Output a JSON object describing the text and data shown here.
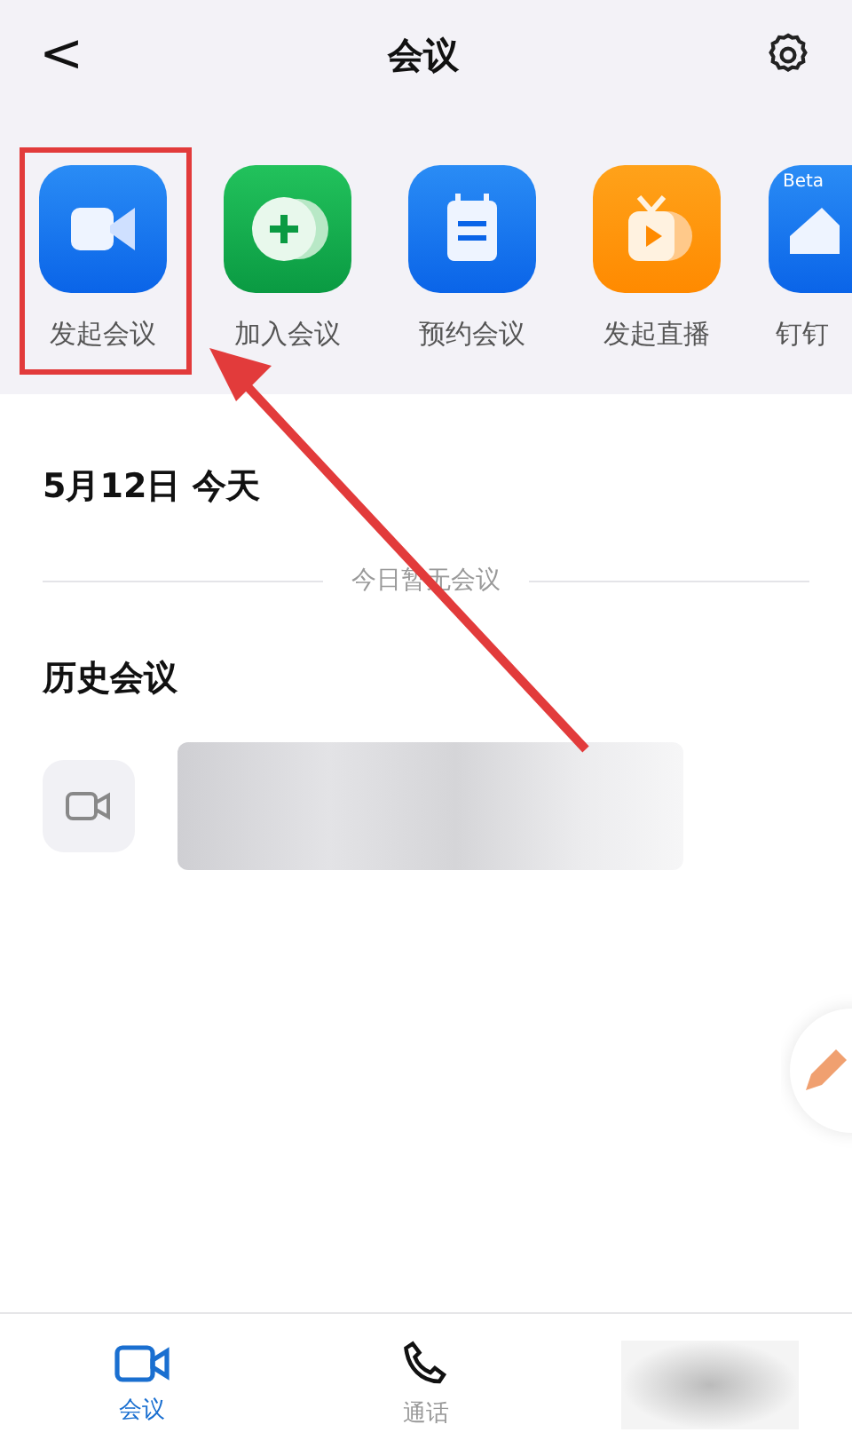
{
  "header": {
    "back": "<",
    "title": "会议"
  },
  "tiles": [
    {
      "label": "发起会议",
      "kind": "video",
      "highlighted": true
    },
    {
      "label": "加入会议",
      "kind": "join",
      "highlighted": false
    },
    {
      "label": "预约会议",
      "kind": "schedule",
      "highlighted": false
    },
    {
      "label": "发起直播",
      "kind": "live",
      "highlighted": false
    },
    {
      "label": "钉钉",
      "kind": "beta",
      "badge": "Beta",
      "highlighted": false
    }
  ],
  "today": {
    "heading": "5月12日 今天",
    "empty": "今日暂无会议"
  },
  "history": {
    "heading": "历史会议"
  },
  "tabbar": [
    {
      "label": "会议",
      "kind": "meeting",
      "selected": true
    },
    {
      "label": "通话",
      "kind": "call",
      "selected": false
    },
    {
      "kind": "blurred",
      "selected": false
    }
  ]
}
